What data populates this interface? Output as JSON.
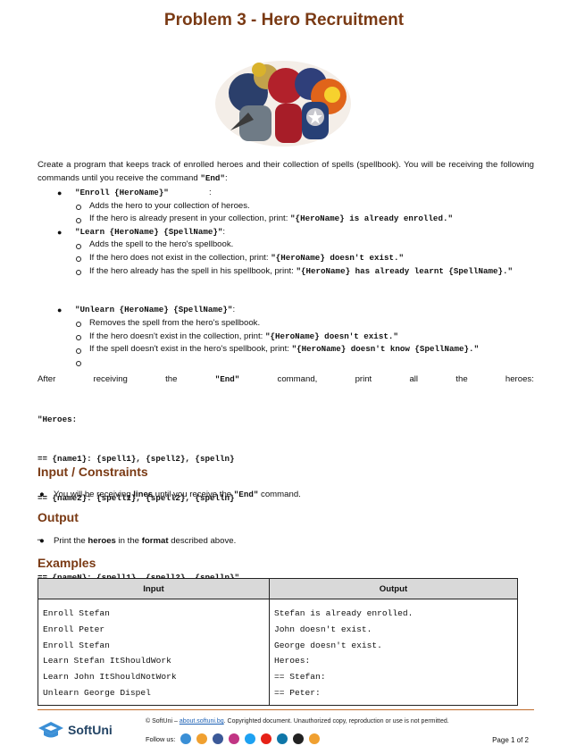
{
  "title": "Problem 3 - Hero Recruitment",
  "intro": {
    "text": "Create a program that keeps track of enrolled heroes and their collection of spells (spellbook). You will be receiving the following commands until you receive the command ",
    "end_cmd": "\"End\"",
    "tail": ":"
  },
  "commands": [
    {
      "name": "\"Enroll {HeroName}\"",
      "items": [
        [
          "Adds the hero to your collection of heroes.",
          ""
        ],
        [
          "If the hero is already present in your collection, print: ",
          "\"{HeroName} is already enrolled.\""
        ]
      ]
    },
    {
      "name": "\"Learn {HeroName} {SpellName}\"",
      "items": [
        [
          "Adds the spell to the hero's spellbook.",
          ""
        ],
        [
          "If the hero does not exist in the collection, print: ",
          "\"{HeroName} doesn't exist.\""
        ],
        [
          "If the hero already has the spell in his spellbook, print: ",
          "\"{HeroName} has already learnt {SpellName}.\""
        ]
      ]
    },
    {
      "name": "\"Unlearn {HeroName} {SpellName}\"",
      "items": [
        [
          "Removes the spell from the hero's spellbook.",
          ""
        ],
        [
          "If the hero doesn't exist in the collection, print: ",
          "\"{HeroName} doesn't exist.\""
        ],
        [
          "If the spell doesn't exist in the hero's spellbook, print: ",
          "\"{HeroName} doesn't know {SpellName}.\""
        ],
        [
          "",
          ""
        ]
      ]
    }
  ],
  "after": {
    "words": [
      "After",
      "receiving",
      "the",
      "\"End\"",
      "command,",
      "print",
      "all",
      "the",
      "heroes:"
    ],
    "format_lines": [
      "\"Heroes:",
      "== {name1}: {spell1}, {spell2}, {spelln}",
      "== {name2}: {spell1}, {spell2}, {spelln}",
      "…",
      "== {nameN}: {spell1}, {spell2}, {spelln}\""
    ]
  },
  "input_section": {
    "heading": "Input / Constraints",
    "bullet_pre": "You will be receiving ",
    "bullet_bold": "lines",
    "bullet_mid": " until you receive the ",
    "bullet_cmd": "\"End\"",
    "bullet_post": " command."
  },
  "output_section": {
    "heading": "Output",
    "bullet_pre": "Print the ",
    "bullet_b1": "heroes",
    "bullet_mid": " in the ",
    "bullet_b2": "format",
    "bullet_post": " described above."
  },
  "examples": {
    "heading": "Examples",
    "col_input": "Input",
    "col_output": "Output",
    "input_lines": [
      "Enroll Stefan",
      "Enroll Peter",
      "Enroll Stefan",
      "Learn Stefan ItShouldWork",
      "Learn John ItShouldNotWork",
      "Unlearn George Dispel"
    ],
    "output_lines": [
      "Stefan is already enrolled.",
      "John doesn't exist.",
      "George doesn't exist.",
      "Heroes:",
      "== Stefan:",
      "== Peter:"
    ]
  },
  "footer": {
    "logo_text": "SoftUni",
    "copyright_pre": "© SoftUni – ",
    "copyright_link": "about.softuni.bg",
    "copyright_post": ". Copyrighted document. Unauthorized copy, reproduction or use is not permitted.",
    "follow_label": "Follow us:",
    "page": "Page 1 of 2",
    "social_icons": [
      "softuni-icon",
      "softuni-alt-icon",
      "facebook-icon",
      "instagram-icon",
      "twitter-icon",
      "youtube-icon",
      "linkedin-icon",
      "github-icon",
      "softuni-blog-icon"
    ],
    "colors": {
      "accent": "#7a3a14",
      "rule": "#c06a2a",
      "brand": "#234465"
    }
  }
}
